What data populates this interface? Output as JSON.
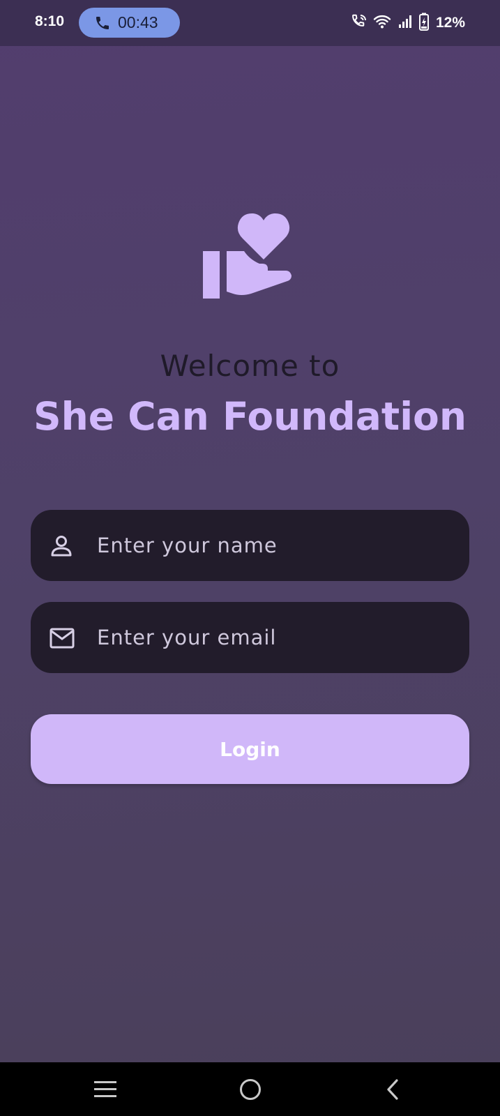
{
  "status_bar": {
    "time": "8:10",
    "call_duration": "00:43",
    "battery_percent": "12%",
    "icons": [
      "phone-icon",
      "wifi-calling-icon",
      "wifi-icon",
      "signal-icon",
      "battery-charging-icon"
    ]
  },
  "welcome": {
    "greeting": "Welcome to",
    "organization": "She Can Foundation",
    "logo_icon": "heart-in-hand-icon"
  },
  "form": {
    "name_placeholder": "Enter your name",
    "name_icon": "person-icon",
    "email_placeholder": "Enter your email",
    "email_icon": "mail-icon",
    "login_label": "Login"
  },
  "nav_bar": {
    "icons": [
      "menu-icon",
      "home-icon",
      "back-icon"
    ]
  },
  "colors": {
    "accent": "#d0b7f9",
    "field_background": "#221c2b",
    "call_pill": "#7b97e6"
  }
}
